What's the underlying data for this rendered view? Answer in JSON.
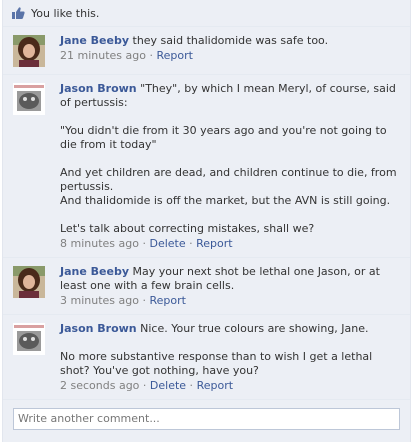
{
  "like_bar": {
    "text": "You like this.",
    "icon": "thumbs-up-icon"
  },
  "comments": [
    {
      "author": "Jane Beeby",
      "paragraphs": [
        "they said thalidomide was safe too."
      ],
      "time": "21 minutes ago",
      "actions": [
        "Report"
      ]
    },
    {
      "author": "Jason Brown",
      "paragraphs": [
        "\"They\", by which I mean Meryl, of course, said of pertussis:",
        "\"You didn't die from it 30 years ago and you're not going to die from it today\"",
        "And yet children are dead, and children continue to die, from pertussis.",
        "And thalidomide is off the market, but the AVN is still going.",
        "Let's talk about correcting mistakes, shall we?"
      ],
      "time": "8 minutes ago",
      "actions": [
        "Delete",
        "Report"
      ]
    },
    {
      "author": "Jane Beeby",
      "paragraphs": [
        "May your next shot be lethal one Jason, or at least one with a few brain cells."
      ],
      "time": "3 minutes ago",
      "actions": [
        "Report"
      ]
    },
    {
      "author": "Jason Brown",
      "paragraphs": [
        "Nice. Your true colours are showing, Jane.",
        "No more substantive response than to wish I get a lethal shot? You've got nothing, have you?"
      ],
      "time": "2 seconds ago",
      "actions": [
        "Delete",
        "Report"
      ]
    }
  ],
  "comment_input": {
    "placeholder": "Write another comment..."
  },
  "colors": {
    "link": "#3b5998",
    "background": "#eceff5",
    "meta": "#808080"
  }
}
